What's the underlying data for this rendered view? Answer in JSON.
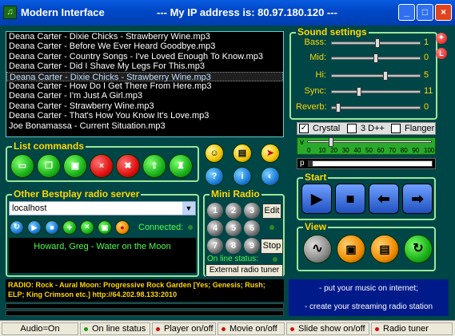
{
  "titlebar": {
    "title": "Modern Interface",
    "ip_text": "--- My IP address is: 80.97.180.120 ---",
    "app_icon": "app-icon"
  },
  "playlist": {
    "items": [
      "Deana Carter - Dixie Chicks - Strawberry Wine.mp3",
      "Deana Carter - Before We Ever Heard Goodbye.mp3",
      "Deana Carter - Country Songs - I've Loved Enough To Know.mp3",
      "Deana Carter - Did I Shave My Legs For This.mp3",
      "Deana Carter - Dixie Chicks - Strawberry Wine.mp3",
      "Deana Carter - How Do I Get There From Here.mp3",
      "Deana Carter - I'm Just A Girl.mp3",
      "Deana Carter - Strawberry Wine.mp3",
      "Deana Carter - That's How You Know It's Love.mp3",
      "Joe Bonamassa - Current Situation.mp3"
    ],
    "selected_index": 4
  },
  "list_commands": {
    "title": "List commands",
    "buttons": [
      "open-folder-icon",
      "copy-icon",
      "save-icon",
      "close-icon",
      "delete-icon",
      "up-arrow-icon",
      "tree-icon"
    ]
  },
  "extra_icons": [
    "smiley-icon",
    "computer-icon",
    "cursor-icon",
    "help-icon",
    "info-icon",
    "shield-icon"
  ],
  "radio_server": {
    "title": "Other Bestplay radio server",
    "server_value": "localhost",
    "connected_label": "Connected:",
    "now_playing": "Howard, Greg - Water on the Moon"
  },
  "mini_radio": {
    "title": "Mini Radio",
    "numbers": [
      "1",
      "2",
      "3",
      "4",
      "5",
      "6",
      "7",
      "8",
      "9"
    ],
    "edit_label": "Edit",
    "stop_label": "Stop",
    "online_label": "On line status:",
    "external_label": "External radio tuner"
  },
  "radio_info": "RADIO: Rock - Aural Moon: Progressive Rock Garden [Yes; Genesis; Rush; ELP; King Crimson etc.] http://64.202.98.133:2010",
  "sound_settings": {
    "title": "Sound settings",
    "sliders": [
      {
        "label": "Bass:",
        "value": "1",
        "level": 0.52
      },
      {
        "label": "Mid:",
        "value": "0",
        "level": 0.5
      },
      {
        "label": "Hi:",
        "value": "5",
        "level": 0.62
      },
      {
        "label": "Sync:",
        "value": "11",
        "level": 0.3
      },
      {
        "label": "Reverb:",
        "value": "0",
        "level": 0.05
      }
    ],
    "checks": [
      {
        "label": "Crystal",
        "checked": true
      },
      {
        "label": "3 D++",
        "checked": false
      },
      {
        "label": "Flanger",
        "checked": false
      }
    ],
    "v_label": "v",
    "scale": [
      "0",
      "10",
      "20",
      "30",
      "40",
      "50",
      "60",
      "70",
      "80",
      "90",
      "100"
    ],
    "volume_level": 0.17,
    "p_label": "p"
  },
  "start": {
    "title": "Start",
    "buttons": [
      "play-icon",
      "stop-icon",
      "previous-icon",
      "next-icon"
    ]
  },
  "view": {
    "title": "View",
    "buttons": [
      "visualizer-icon",
      "window-icon",
      "playlist-view-icon",
      "refresh-icon"
    ]
  },
  "promo": {
    "line1": "- put your music on internet;",
    "line2": "- create your streaming radio station"
  },
  "statusbar": {
    "audio": "Audio=On",
    "online": "On line status",
    "player": "Player on/off",
    "movie": "Movie on/off",
    "slideshow": "Slide show on/off",
    "tuner": "Radio tuner"
  },
  "colors": {
    "background": "#004646",
    "title_accent": "#ffd800",
    "panel_border": "#9be89b",
    "green_text": "#4cff4c"
  }
}
